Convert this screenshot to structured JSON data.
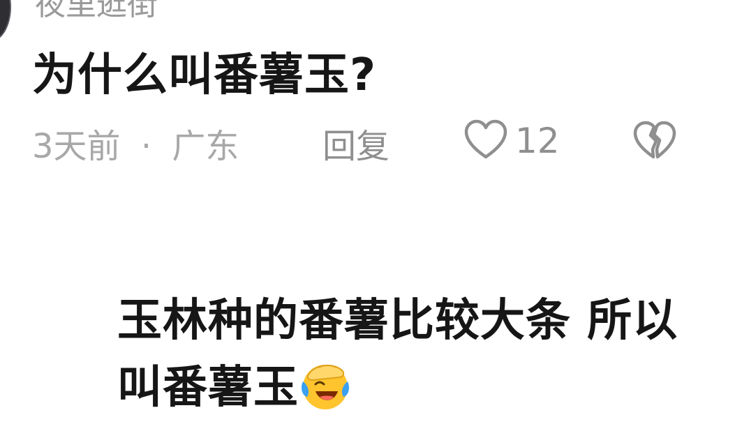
{
  "comment": {
    "username": "夜里逛街",
    "text": "为什么叫番薯玉?",
    "time": "3天前",
    "separator": "·",
    "location": "广东",
    "reply_label": "回复",
    "like_icon": "heart-outline-icon",
    "like_count": "12",
    "dislike_icon": "broken-heart-icon"
  },
  "reply": {
    "text": "玉林种的番薯比较大条 所以叫番薯玉",
    "emoji": "rolling-laughing-face-emoji"
  },
  "colors": {
    "text_primary": "#161616",
    "text_secondary": "#a8a8a8",
    "icon_gray": "#8f8f8f",
    "emoji_yellow": "#ffc42e",
    "emoji_tear_blue": "#3aa0f0"
  }
}
